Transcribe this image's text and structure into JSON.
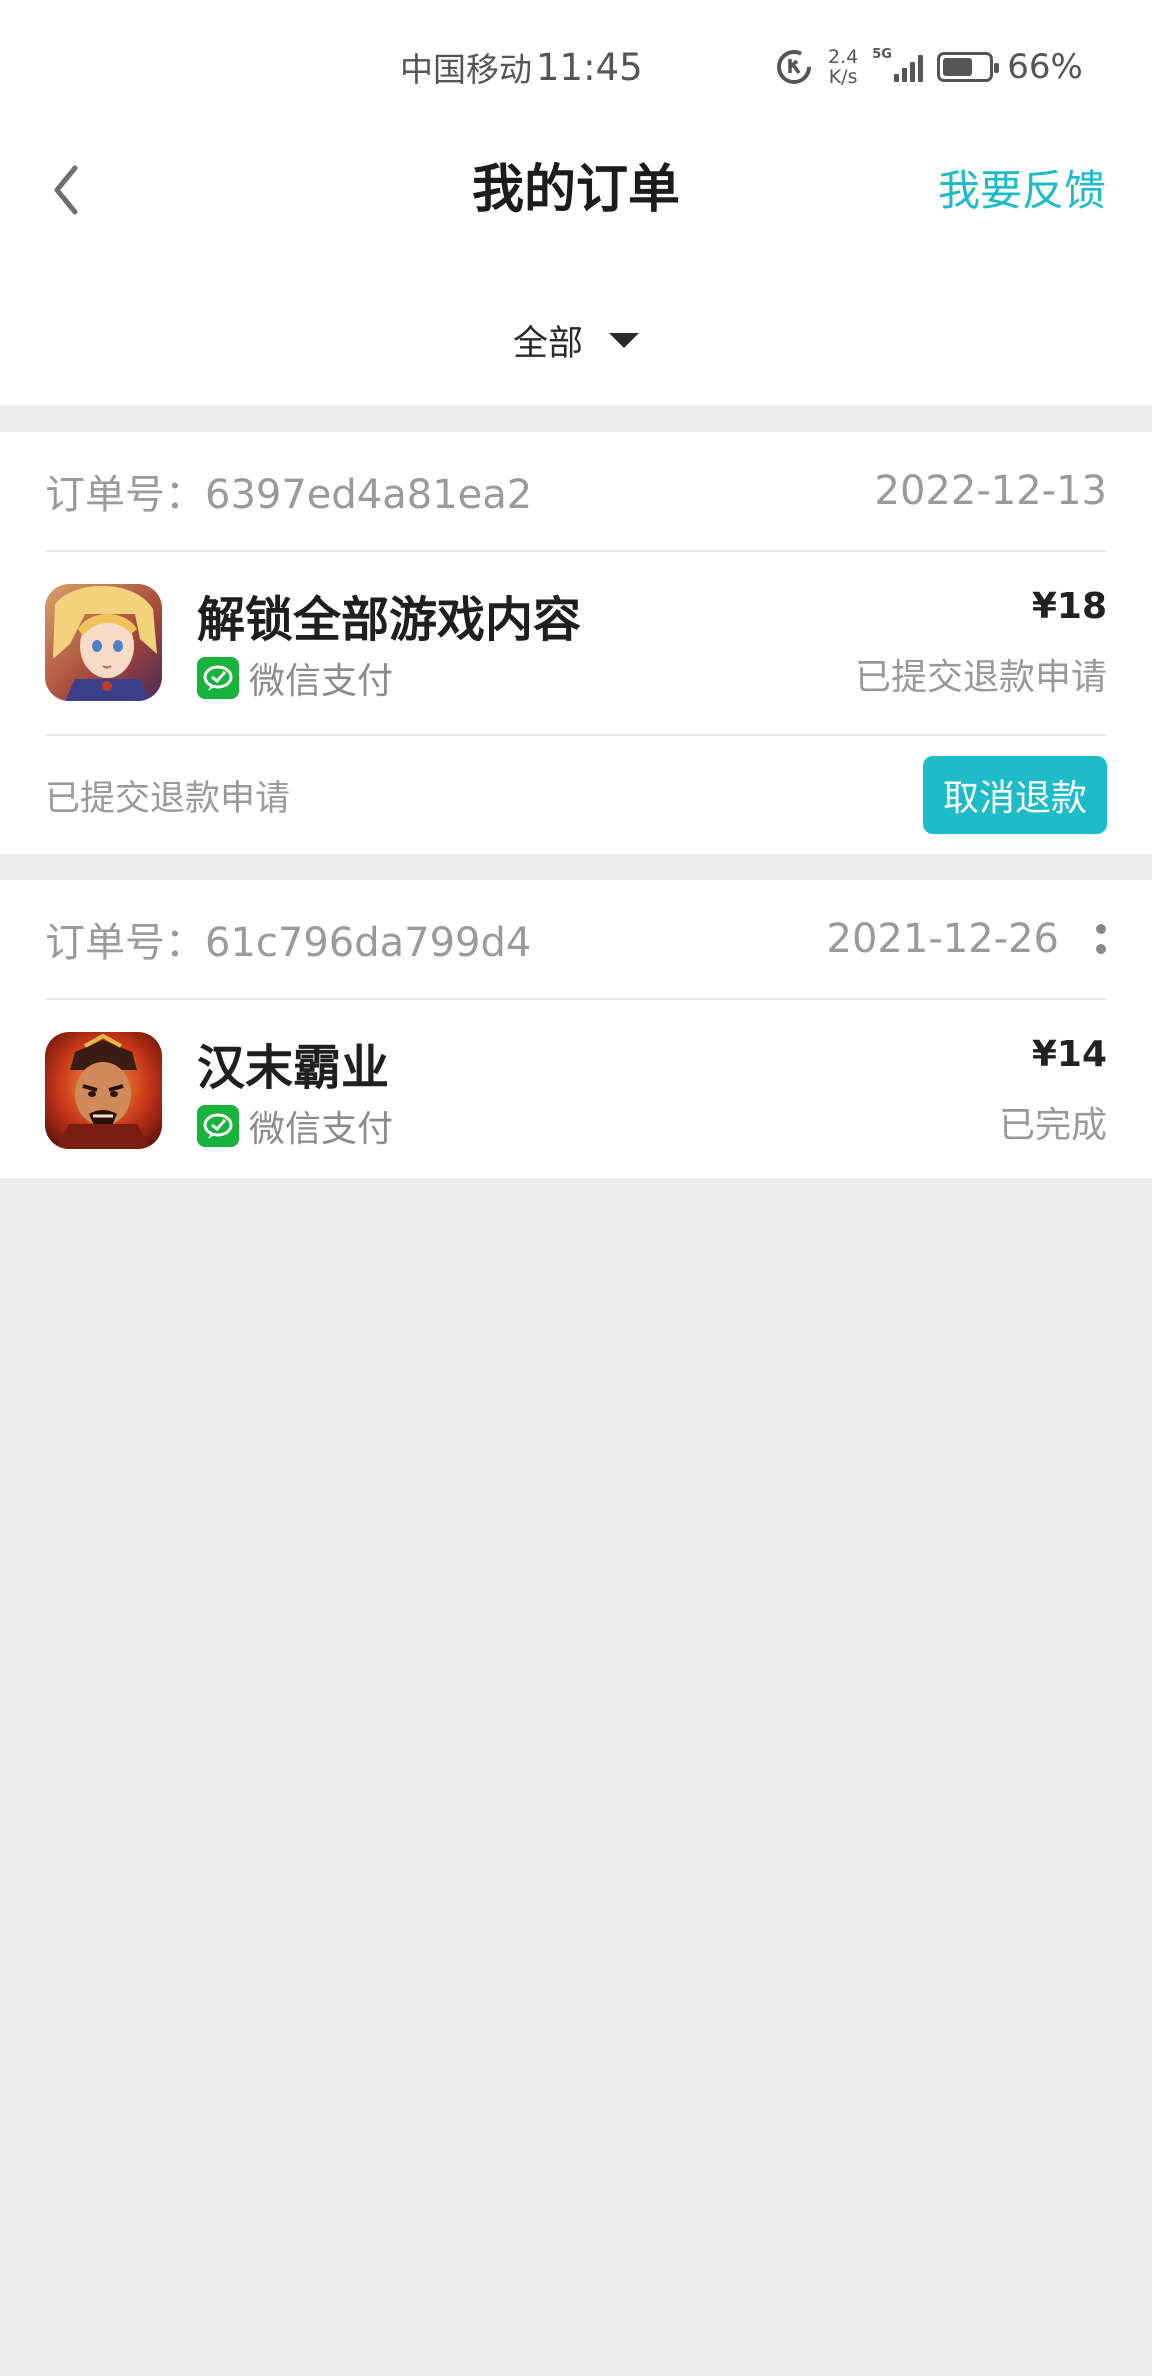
{
  "status_bar": {
    "carrier": "中国移动",
    "time": "11:45",
    "net_speed_value": "2.4",
    "net_speed_unit": "K/s",
    "network_type": "5G",
    "battery_percent": "66%",
    "battery_level": 0.66
  },
  "header": {
    "title": "我的订单",
    "feedback": "我要反馈",
    "back_icon": "chevron-left-icon"
  },
  "filter": {
    "label": "全部",
    "arrow_icon": "caret-down-icon"
  },
  "colors": {
    "accent": "#1dbcc8",
    "wechat_green": "#19b23a",
    "page_background": "#ededed"
  },
  "orders": [
    {
      "order_no": "订单号：6397ed4a81ea2",
      "date": "2022-12-13",
      "product": "解锁全部游戏内容",
      "payment": "微信支付",
      "price": "¥18",
      "status": "已提交退款申请",
      "footer_status": "已提交退款申请",
      "action": "取消退款",
      "icon": "anime-character-app-icon"
    },
    {
      "order_no": "订单号：61c796da799d4",
      "date": "2021-12-26",
      "product": "汉末霸业",
      "payment": "微信支付",
      "price": "¥14",
      "status": "已完成",
      "icon": "warrior-game-app-icon",
      "more_icon": "more-vertical-icon"
    }
  ]
}
